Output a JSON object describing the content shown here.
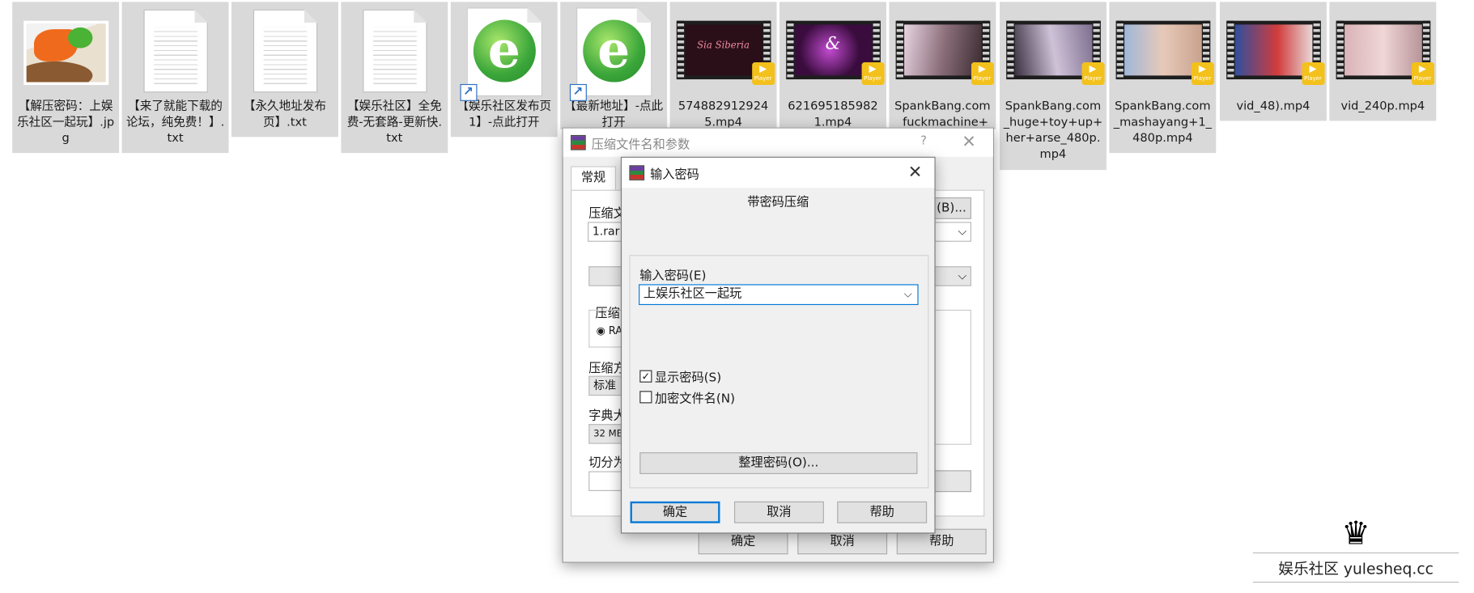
{
  "files": [
    {
      "label": "【解压密码：上娱乐社区一起玩】.jpg",
      "type": "jpg"
    },
    {
      "label": "【来了就能下载的论坛，纯免费！】.txt",
      "type": "txt"
    },
    {
      "label": "【永久地址发布页】.txt",
      "type": "txt"
    },
    {
      "label": "【娱乐社区】全免费-无套路-更新快.txt",
      "type": "txt"
    },
    {
      "label": "【娱乐社区发布页1】-点此打开",
      "type": "link"
    },
    {
      "label": "【最新地址】-点此打开",
      "type": "link"
    },
    {
      "label": "5748829129245.mp4",
      "type": "video",
      "tint": "#2a0f18",
      "overlay": "Sia Siberia"
    },
    {
      "label": "6216951859821.mp4",
      "type": "video",
      "tint": "#3a0c3e",
      "overlay": "&"
    },
    {
      "label": "SpankBang.com_fuckmachine+",
      "type": "video",
      "tint": "#8b6f7a"
    },
    {
      "label": "SpankBang.com_huge+toy+up+her+arse_480p.mp4",
      "type": "video",
      "tint": "#7d6f8f"
    },
    {
      "label": "SpankBang.com_mashayang+1_480p.mp4",
      "type": "video",
      "tint": "#c9a28f"
    },
    {
      "label": "vid_48).mp4",
      "type": "video",
      "tint": "#4b5c8e"
    },
    {
      "label": "vid_240p.mp4",
      "type": "video",
      "tint": "#c7a2a2"
    }
  ],
  "badge": {
    "text": "Player",
    "icon": "play-icon"
  },
  "archive_dialog": {
    "title": "压缩文件名和参数",
    "help_glyph": "?",
    "tab_general": "常规",
    "archive_name_label": "压缩文",
    "archive_name_value": "1.rar",
    "browse_button": "(B)...",
    "format_group_label": "压缩",
    "format_option": "RA",
    "method_label": "压缩方",
    "method_value": "标准",
    "dict_label": "字典大",
    "dict_value": "32 MB",
    "split_label": "切分为",
    "ok": "确定",
    "cancel": "取消",
    "help": "帮助"
  },
  "password_dialog": {
    "title": "输入密码",
    "heading": "带密码压缩",
    "input_label": "输入密码(E)",
    "password_value": "上娱乐社区一起玩",
    "show_password": {
      "label": "显示密码(S)",
      "checked": true
    },
    "encrypt_names": {
      "label": "加密文件名(N)",
      "checked": false
    },
    "organize_button": "整理密码(O)...",
    "ok": "确定",
    "cancel": "取消",
    "help": "帮助"
  },
  "watermark": {
    "text": "娱乐社区 yulesheq.cc",
    "icon": "crown-icon"
  }
}
